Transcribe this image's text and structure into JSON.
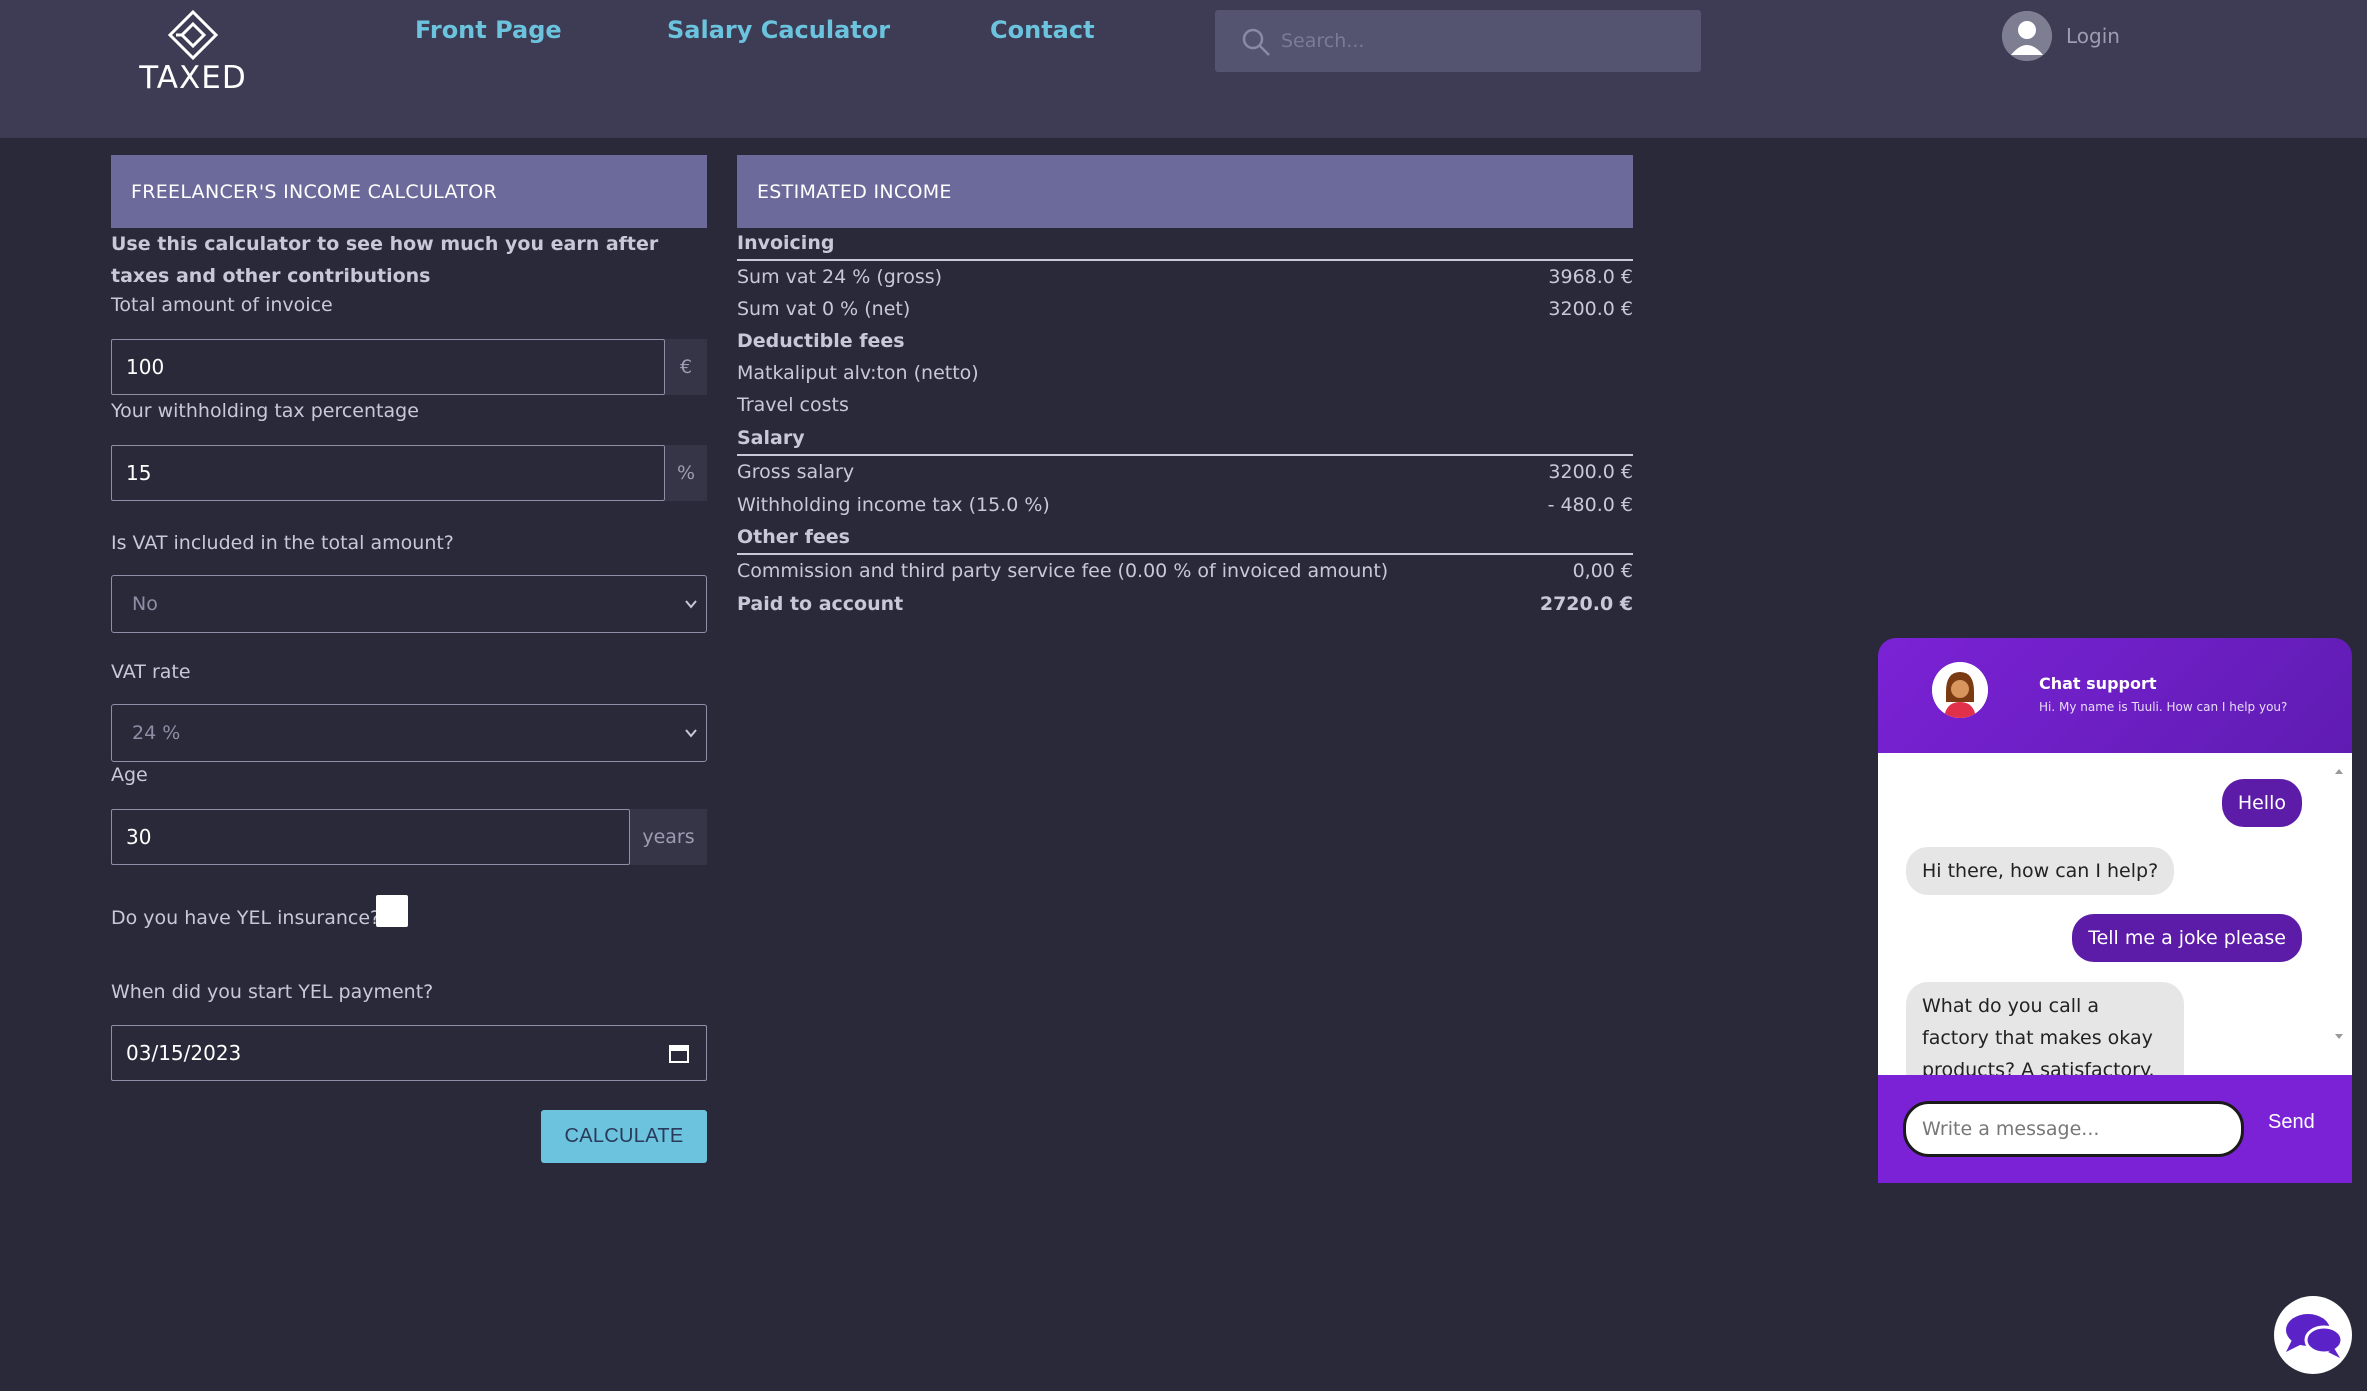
{
  "header": {
    "logo_text": "TAXED",
    "nav": [
      "Front Page",
      "Salary Caculator",
      "Contact"
    ],
    "search_placeholder": "Search...",
    "login_label": "Login"
  },
  "calculator": {
    "title": "FREELANCER'S INCOME CALCULATOR",
    "intro": "Use this calculator to see how much you earn after taxes and other contributions",
    "invoice_label": "Total amount of invoice",
    "invoice_value": "100",
    "invoice_unit": "€",
    "tax_label": "Your withholding tax percentage",
    "tax_value": "15",
    "tax_unit": "%",
    "vat_included_label": "Is VAT included in the total amount?",
    "vat_included_value": "No",
    "vat_rate_label": "VAT rate",
    "vat_rate_value": "24 %",
    "age_label": "Age",
    "age_value": "30",
    "age_unit": "years",
    "yel_label": "Do you have YEL insurance?",
    "yel_start_label": "When did you start YEL payment?",
    "yel_start_value": "03/15/2023",
    "calculate_label": "CALCULATE"
  },
  "results": {
    "title": "ESTIMATED INCOME",
    "invoicing": "Invoicing",
    "sum_gross_label": "Sum vat 24 % (gross)",
    "sum_gross_value": "3968.0 €",
    "sum_net_label": "Sum vat 0 % (net)",
    "sum_net_value": "3200.0 €",
    "deductible": "Deductible fees",
    "travel_tickets": "Matkaliput alv:ton (netto)",
    "travel_costs": "Travel costs",
    "salary": "Salary",
    "gross_salary_label": "Gross salary",
    "gross_salary_value": "3200.0 €",
    "withholding_label": "Withholding income tax (15.0 %)",
    "withholding_value": "- 480.0 €",
    "other_fees": "Other fees",
    "commission_label": "Commission and third party service fee (0.00 % of invoiced amount)",
    "commission_value": "0,00 €",
    "paid_label": "Paid to account",
    "paid_value": "2720.0 €"
  },
  "chat": {
    "title": "Chat support",
    "subtitle": "Hi. My name is Tuuli. How can I help you?",
    "messages": [
      {
        "from": "user",
        "text": "Hello"
      },
      {
        "from": "bot",
        "text": "Hi there, how can I help?"
      },
      {
        "from": "user",
        "text": "Tell me a joke please"
      },
      {
        "from": "bot",
        "text": "What do you call a factory that makes okay products? A satisfactory."
      }
    ],
    "input_placeholder": "Write a message...",
    "send_label": "Send"
  },
  "colors": {
    "background": "#2a2939",
    "header": "#3d3c54",
    "panel_header": "#6b6a9b",
    "accent": "#6cc3de",
    "chat_purple": "#7b22d6"
  }
}
